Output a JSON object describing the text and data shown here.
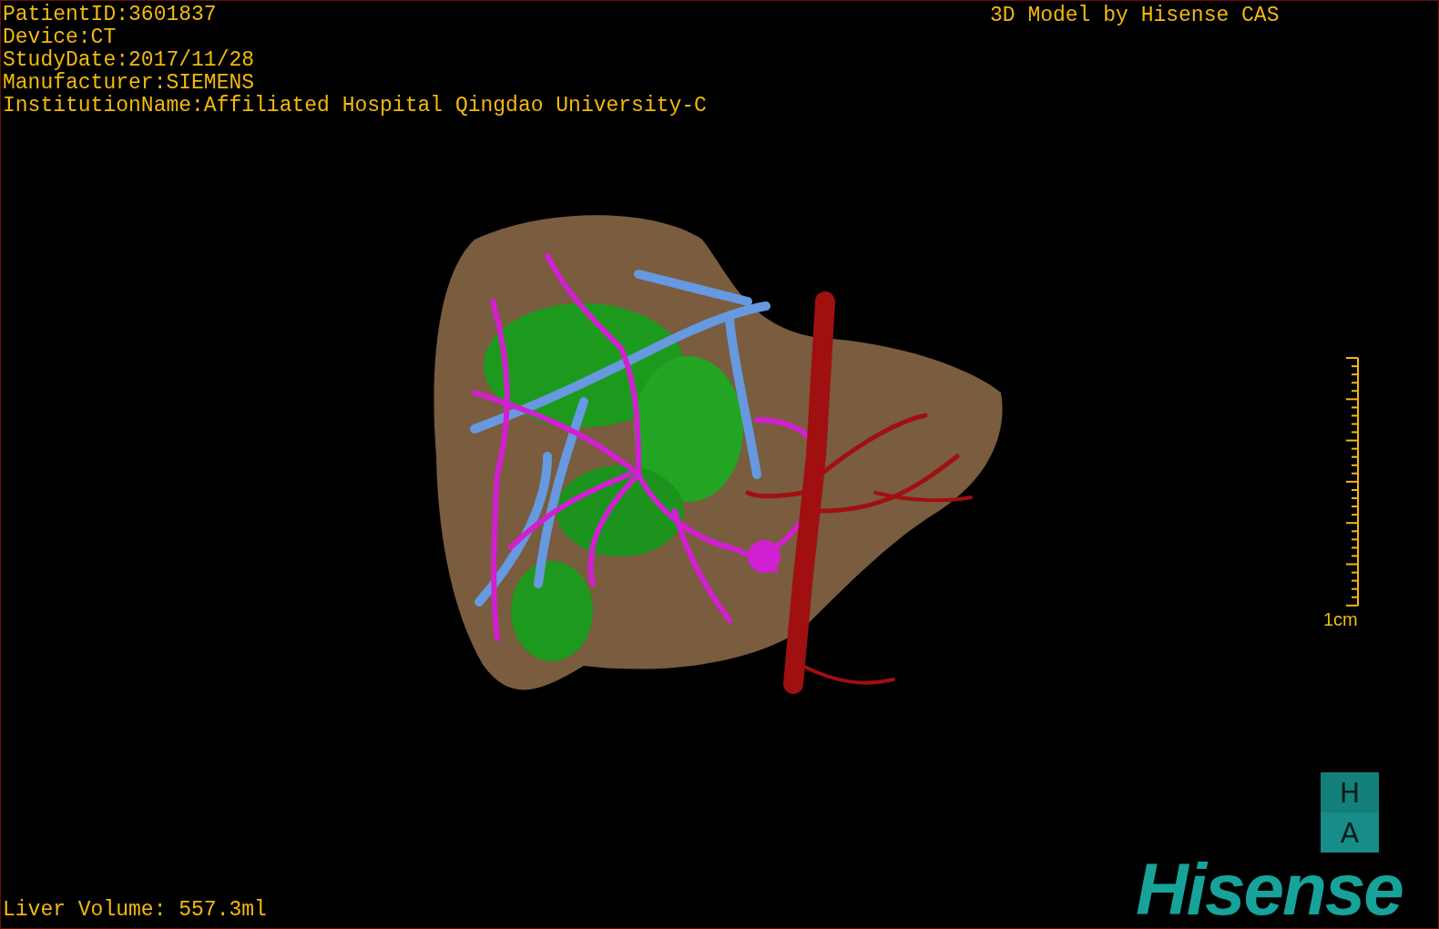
{
  "info_lines": [
    "PatientID:3601837",
    "Device:CT",
    "StudyDate:2017/11/28",
    "Manufacturer:SIEMENS",
    "InstitutionName:Affiliated Hospital Qingdao University-C"
  ],
  "title": "3D Model by Hisense CAS",
  "scale_label": "1cm",
  "orientation": [
    "H",
    "A"
  ],
  "logo": "Hisense",
  "liver_volume": "Liver Volume: 557.3ml"
}
